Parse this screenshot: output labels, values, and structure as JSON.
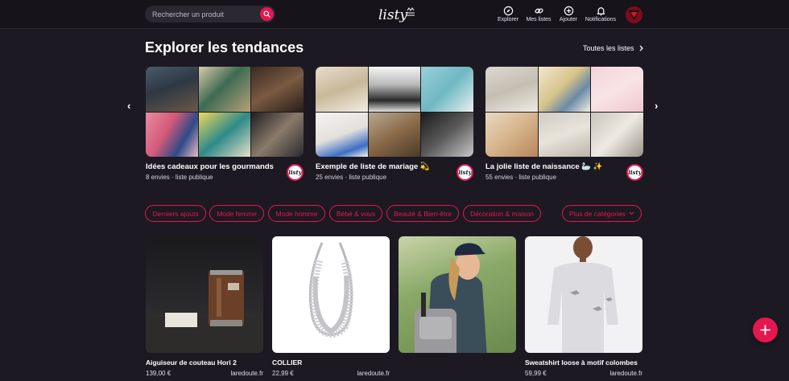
{
  "search": {
    "placeholder": "Rechercher un produit"
  },
  "logo": {
    "text": "listy"
  },
  "nav": {
    "explore": "Explorer",
    "my_lists": "Mes listes",
    "add": "Ajouter",
    "notifications": "Notifications"
  },
  "trends": {
    "title": "Explorer les tendances",
    "all_lists": "Toutes les listes",
    "prev": "‹",
    "next": "›",
    "cards": [
      {
        "title": "Idées cadeaux pour les gourmands",
        "meta": "8 envies · liste publique",
        "badge": "listy"
      },
      {
        "title": "Exemple de liste de mariage 💫",
        "meta": "25 envies · liste publique",
        "badge": "listy"
      },
      {
        "title": "La jolie liste de naissance 🦢 ✨",
        "meta": "55 envies · liste publique",
        "badge": "listy"
      }
    ]
  },
  "categories": {
    "chips": [
      "Derniers ajouts",
      "Mode femme",
      "Mode homme",
      "Bébé & vous",
      "Beauté & Bien-être",
      "Décoration & maison"
    ],
    "more": "Plus de catégories"
  },
  "products": [
    {
      "name": "Aiguiseur de couteau Hori 2",
      "price": "139,00 €",
      "shop": "laredoute.fr"
    },
    {
      "name": "COLLIER",
      "price": "22,99 €",
      "shop": "laredoute.fr"
    },
    {
      "name": "",
      "price": "",
      "shop": ""
    },
    {
      "name": "Sweatshirt loose à motif colombes",
      "price": "59,99 €",
      "shop": "laredoute.fr"
    }
  ],
  "colors": {
    "accent": "#e5174f",
    "background": "#1c1922",
    "header": "#16131b"
  },
  "icons": [
    "search-icon",
    "compass-icon",
    "link-icon",
    "plus-circle-icon",
    "bell-icon",
    "chevron-right-icon",
    "chevron-down-icon",
    "plus-icon"
  ]
}
